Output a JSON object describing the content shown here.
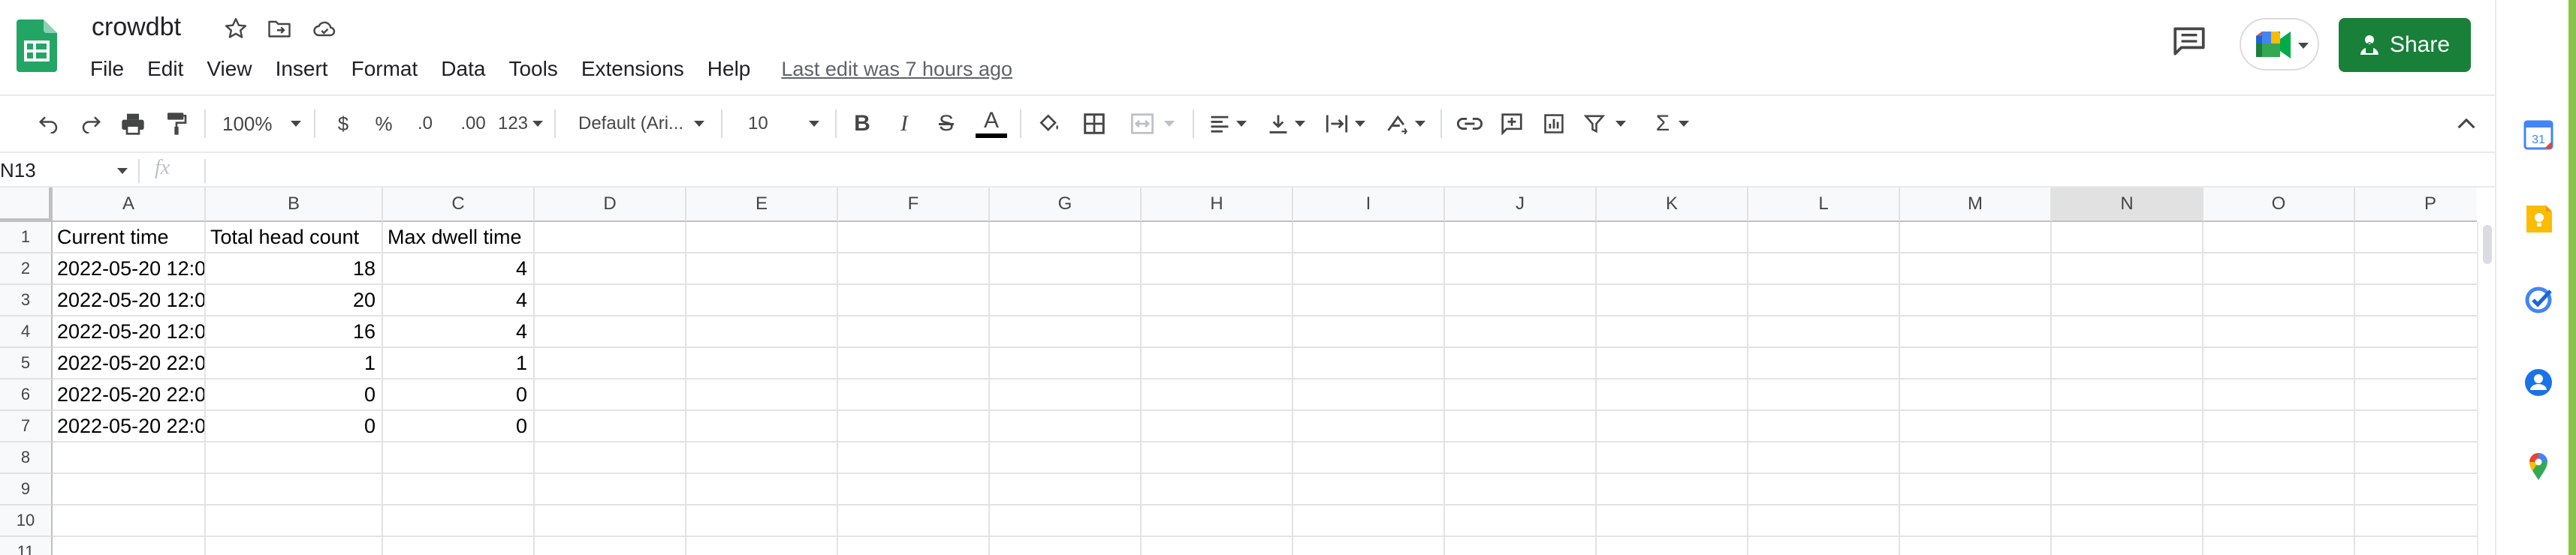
{
  "document": {
    "title": "crowdbt",
    "last_edit": "Last edit was 7 hours ago"
  },
  "menu": [
    "File",
    "Edit",
    "View",
    "Insert",
    "Format",
    "Data",
    "Tools",
    "Extensions",
    "Help"
  ],
  "share": {
    "label": "Share"
  },
  "toolbar": {
    "zoom": "100%",
    "currency": "$",
    "percent": "%",
    "decrease_decimal": ".0",
    "increase_decimal": ".00",
    "more_formats": "123",
    "font": "Default (Ari...",
    "font_size": "10"
  },
  "formula_bar": {
    "name_box": "N13",
    "fx": "fx",
    "value": ""
  },
  "sheet": {
    "columns": [
      "A",
      "B",
      "C",
      "D",
      "E",
      "F",
      "G",
      "H",
      "I",
      "J",
      "K",
      "L",
      "M",
      "N",
      "O",
      "P"
    ],
    "selected_column": "N",
    "row_numbers": [
      "1",
      "2",
      "3",
      "4",
      "5",
      "6",
      "7",
      "8",
      "9",
      "10",
      "11"
    ],
    "header_row": [
      "Current time",
      "Total head count",
      "Max dwell time"
    ],
    "rows": [
      [
        "2022-05-20 12:0",
        "18",
        "4"
      ],
      [
        "2022-05-20 12:0",
        "20",
        "4"
      ],
      [
        "2022-05-20 12:0",
        "16",
        "4"
      ],
      [
        "2022-05-20 22:0",
        "1",
        "1"
      ],
      [
        "2022-05-20 22:0",
        "0",
        "0"
      ],
      [
        "2022-05-20 22:0",
        "0",
        "0"
      ]
    ]
  },
  "side_panel": {
    "calendar_day": "31",
    "icons": [
      "calendar-icon",
      "keep-icon",
      "tasks-icon",
      "contacts-icon",
      "maps-icon"
    ]
  },
  "colors": {
    "share_button": "#188038",
    "sheets_logo": "#23a566",
    "selected_header": "#e1e1e1"
  }
}
